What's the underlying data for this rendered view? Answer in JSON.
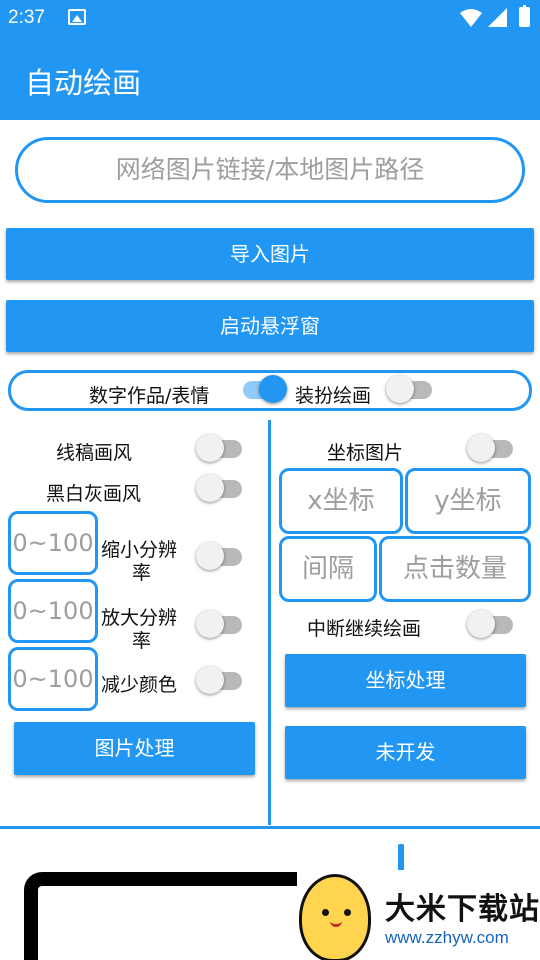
{
  "status_bar": {
    "time": "2:37",
    "icons": [
      "image-icon",
      "wifi-icon",
      "signal-icon",
      "battery-icon"
    ]
  },
  "app_bar": {
    "title": "自动绘画"
  },
  "url_input": {
    "placeholder": "网络图片链接/本地图片路径",
    "value": ""
  },
  "buttons": {
    "import": "导入图片",
    "float_window": "启动悬浮窗",
    "image_process": "图片处理",
    "coord_process": "坐标处理",
    "undeveloped": "未开发"
  },
  "mode": {
    "left_label": "数字作品/表情",
    "left_on": true,
    "right_label": "装扮绘画",
    "right_on": false
  },
  "left_panel": {
    "line_art": {
      "label": "线稿画风",
      "on": false
    },
    "grayscale": {
      "label": "黑白灰画风",
      "on": false
    },
    "reduce_res": {
      "label_line1": "缩小分辨",
      "label_line2": "率",
      "placeholder": "0~100",
      "on": false
    },
    "enlarge_res": {
      "label_line1": "放大分辨",
      "label_line2": "率",
      "placeholder": "0~100",
      "on": false
    },
    "reduce_colors": {
      "label": "减少颜色",
      "placeholder": "0~100",
      "on": false
    }
  },
  "right_panel": {
    "coord_image": {
      "label": "坐标图片",
      "on": false
    },
    "x_coord": {
      "placeholder": "x坐标"
    },
    "y_coord": {
      "placeholder": "y坐标"
    },
    "interval": {
      "placeholder": "间隔"
    },
    "click_count": {
      "placeholder": "点击数量"
    },
    "resume": {
      "label": "中断继续绘画",
      "on": false
    }
  },
  "watermark": {
    "title": "大米下载站",
    "url": "www.zzhyw.com"
  },
  "colors": {
    "primary": "#2196f3",
    "switch_track_off": "#b9b9b9",
    "switch_thumb_off": "#f1f1f1",
    "placeholder": "#9e9e9e"
  }
}
